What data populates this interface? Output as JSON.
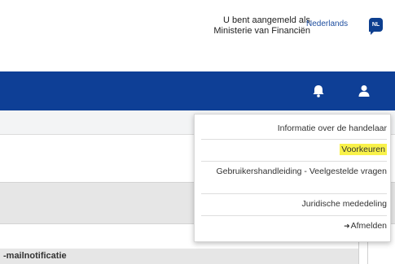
{
  "header": {
    "login_line1": "U bent aangemeld als",
    "login_line2": "Ministerie van Financiën",
    "language_link": "Nederlands",
    "language_badge": "NL"
  },
  "navbar": {
    "icons": [
      "bell-icon",
      "user-icon"
    ],
    "color": "#0e3f96"
  },
  "user_menu": {
    "items": [
      {
        "label": "Informatie over de handelaar"
      },
      {
        "label": "Voorkeuren",
        "highlighted": true
      },
      {
        "label": "Gebruikershandleiding - Veelgestelde vragen"
      },
      {
        "label": "Juridische mededeling"
      },
      {
        "label": "Afmelden"
      }
    ],
    "highlight_color": "#f9f24a"
  },
  "content": {
    "section_label": "-mailnotificatie"
  }
}
